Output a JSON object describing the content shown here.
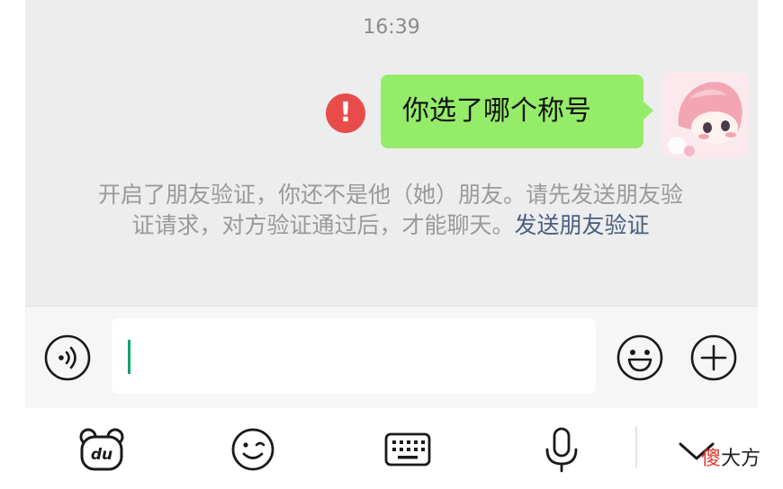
{
  "chat": {
    "timestamp": "16:39",
    "message": {
      "text": "你选了哪个称号",
      "status": "failed"
    },
    "notice": {
      "text": "开启了朋友验证，你还不是他（她）朋友。请先发送朋友验证请求，对方验证通过后，才能聊天。",
      "link": "发送朋友验证"
    }
  },
  "input_bar": {
    "value": "",
    "left_icon": "voice-icon",
    "right_icons": [
      "emoji-icon",
      "plus-icon"
    ]
  },
  "keyboard_toolbar": {
    "icons": [
      "du-icon",
      "face-icon",
      "keyboard-icon",
      "microphone-icon",
      "chevron-down-icon"
    ]
  },
  "watermark": {
    "first_char": "傻",
    "rest": "大方"
  },
  "colors": {
    "bubble": "#95ec69",
    "error": "#e94b4b",
    "link": "#4b5e80",
    "caret": "#13a36a"
  }
}
